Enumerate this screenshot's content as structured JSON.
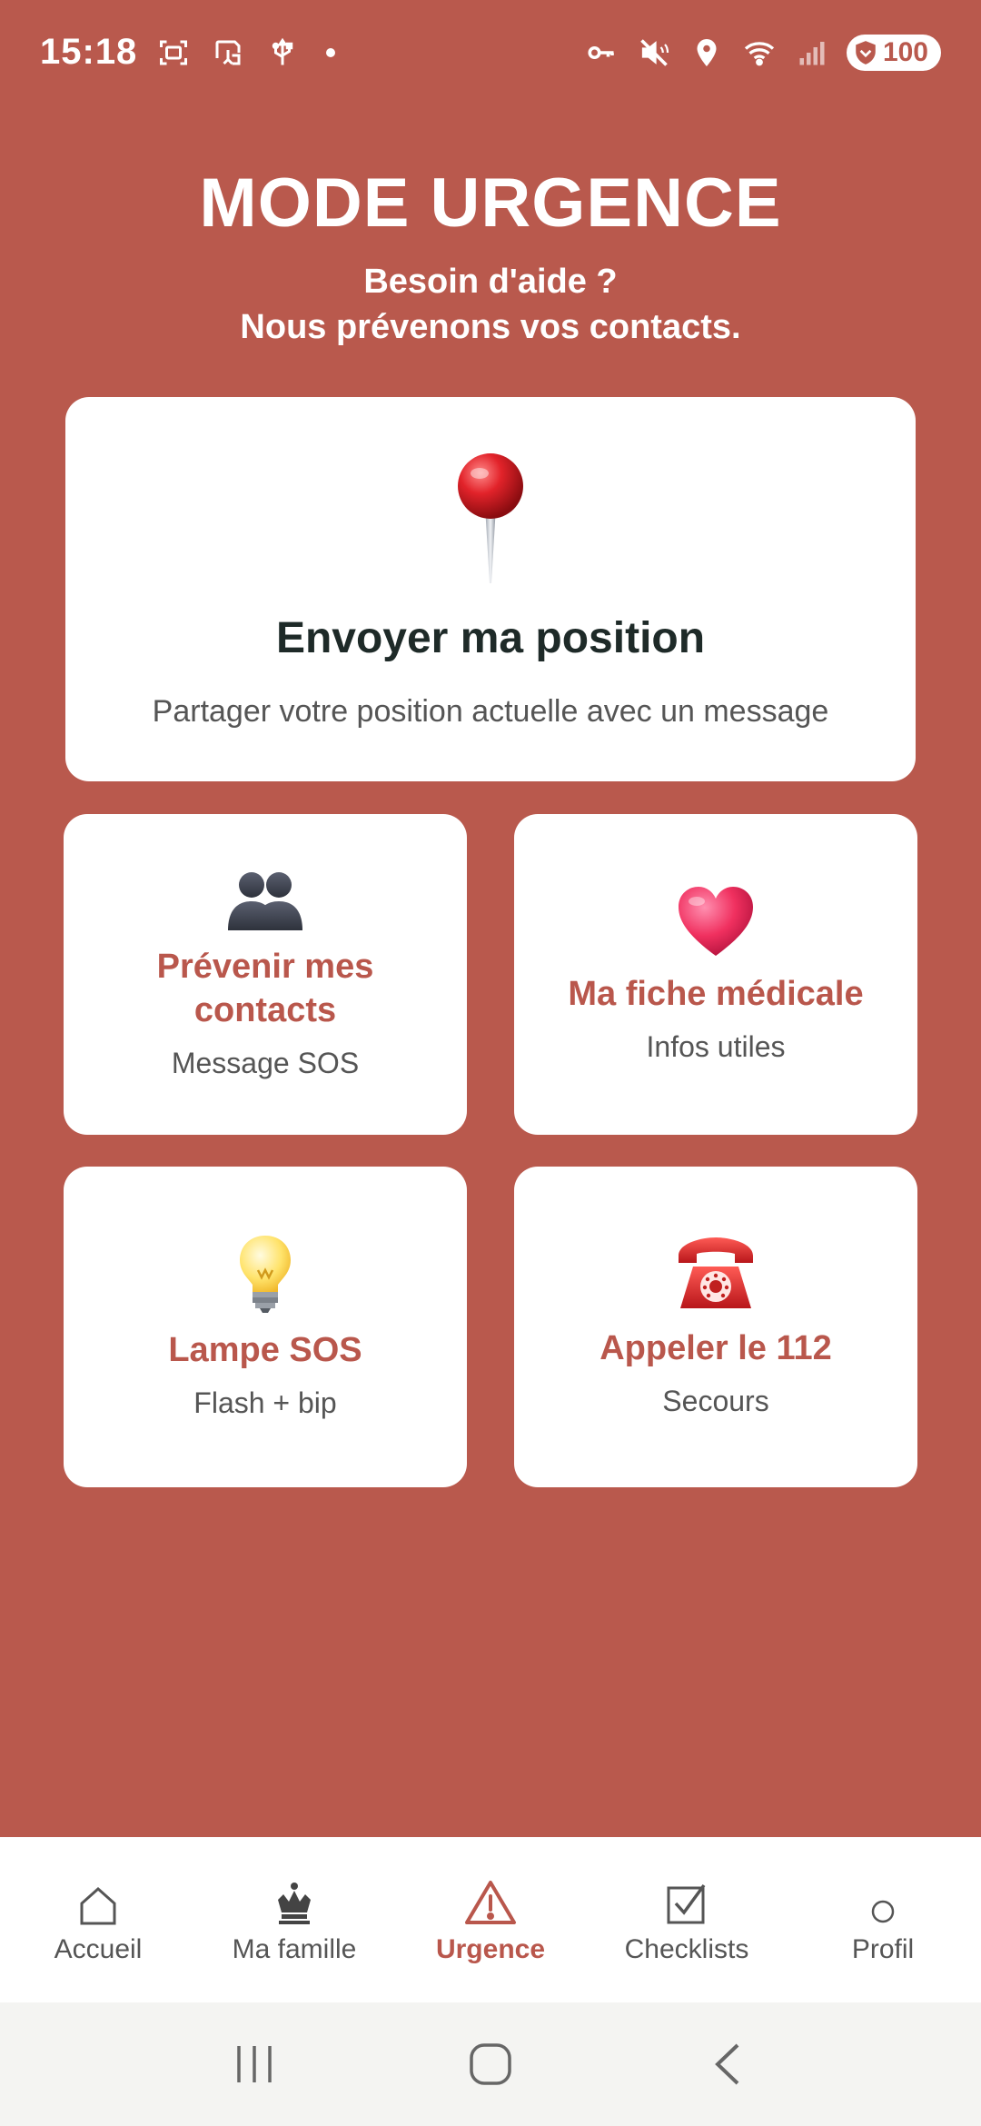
{
  "status_bar": {
    "time": "15:18",
    "battery": "100",
    "icons_left": [
      "screenshot-icon",
      "cast-icon",
      "usb-icon",
      "dot-icon"
    ],
    "icons_right": [
      "key-icon",
      "mute-icon",
      "location-icon",
      "wifi-icon",
      "signal-icon",
      "battery-icon"
    ]
  },
  "header": {
    "title": "MODE URGENCE",
    "subtitle_line1": "Besoin d'aide ?",
    "subtitle_line2": "Nous prévenons vos contacts."
  },
  "cards": {
    "position": {
      "title": "Envoyer ma position",
      "desc": "Partager votre position actuelle avec un message",
      "icon": "pushpin-icon"
    },
    "contacts": {
      "title_line1": "Prévenir mes",
      "title_line2": "contacts",
      "desc": "Message SOS",
      "icon": "people-icon"
    },
    "medical": {
      "title": "Ma fiche médicale",
      "desc": "Infos utiles",
      "icon": "heart-icon"
    },
    "lamp": {
      "title": "Lampe SOS",
      "desc": "Flash + bip",
      "icon": "lightbulb-icon"
    },
    "call": {
      "title": "Appeler le 112",
      "desc": "Secours",
      "icon": "telephone-icon"
    }
  },
  "bottom_nav": {
    "items": [
      {
        "label": "Accueil",
        "icon": "home-icon"
      },
      {
        "label": "Ma famille",
        "icon": "crown-icon"
      },
      {
        "label": "Urgence",
        "icon": "warning-icon",
        "active": true
      },
      {
        "label": "Checklists",
        "icon": "checkbox-icon"
      },
      {
        "label": "Profil",
        "icon": "circle-icon"
      }
    ]
  },
  "colors": {
    "background": "#b9594d",
    "accent": "#b9574c",
    "card": "#ffffff"
  }
}
